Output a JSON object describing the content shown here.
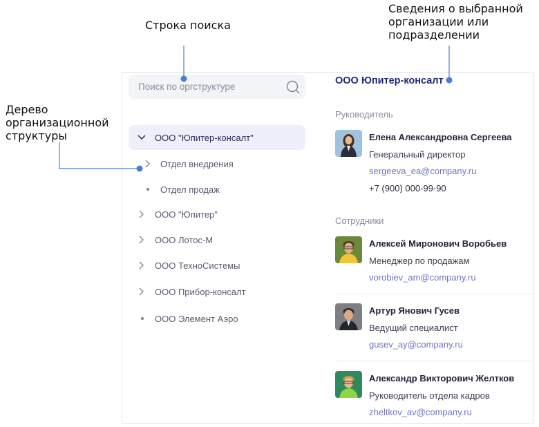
{
  "annotations": {
    "search": "Строка поиска",
    "details": [
      "Сведения о выбранной",
      "организации или",
      "подразделении"
    ],
    "tree": [
      "Дерево",
      "организационной",
      "структуры"
    ]
  },
  "search": {
    "placeholder": "Поиск по оргструктуре"
  },
  "tree": {
    "items": [
      {
        "label": "ООО \"Юпитер-консалт\"",
        "state": "expanded",
        "selected": true
      },
      {
        "label": "Отдел внедрения",
        "state": "collapsed",
        "level": 1
      },
      {
        "label": "Отдел продаж",
        "state": "leaf",
        "level": 1
      },
      {
        "label": "ООО \"Юпитер\"",
        "state": "collapsed"
      },
      {
        "label": "ООО Лотос-М",
        "state": "collapsed"
      },
      {
        "label": "ООО ТехноСистемы",
        "state": "collapsed"
      },
      {
        "label": "ООО Прибор-консалт",
        "state": "collapsed"
      },
      {
        "label": "ООО Элемент Аэро",
        "state": "leaf"
      }
    ]
  },
  "details": {
    "title": "ООО Юпитер-консалт",
    "head_label": "Руководитель",
    "head": {
      "name": "Елена Александровна Сергеева",
      "role": "Генеральный директор",
      "email": "sergeeva_ea@company.ru",
      "phone": "+7 (900) 000-99-90"
    },
    "employees_label": "Сотрудники",
    "employees": [
      {
        "name": "Алексей Миронович Воробьев",
        "role": "Менеджер по продажам",
        "email": "vorobiev_am@company.ru"
      },
      {
        "name": "Артур Янович Гусев",
        "role": "Ведущий специалист",
        "email": "gusev_ay@company.ru"
      },
      {
        "name": "Александр Викторович Желтков",
        "role": "Руководитель отдела кадров",
        "email": "zheltkov_av@company.ru"
      }
    ]
  },
  "colors": {
    "accent": "#4a7fd0",
    "title": "#22267a",
    "link": "#6f74c4",
    "selected_bg": "#eeeffb"
  }
}
